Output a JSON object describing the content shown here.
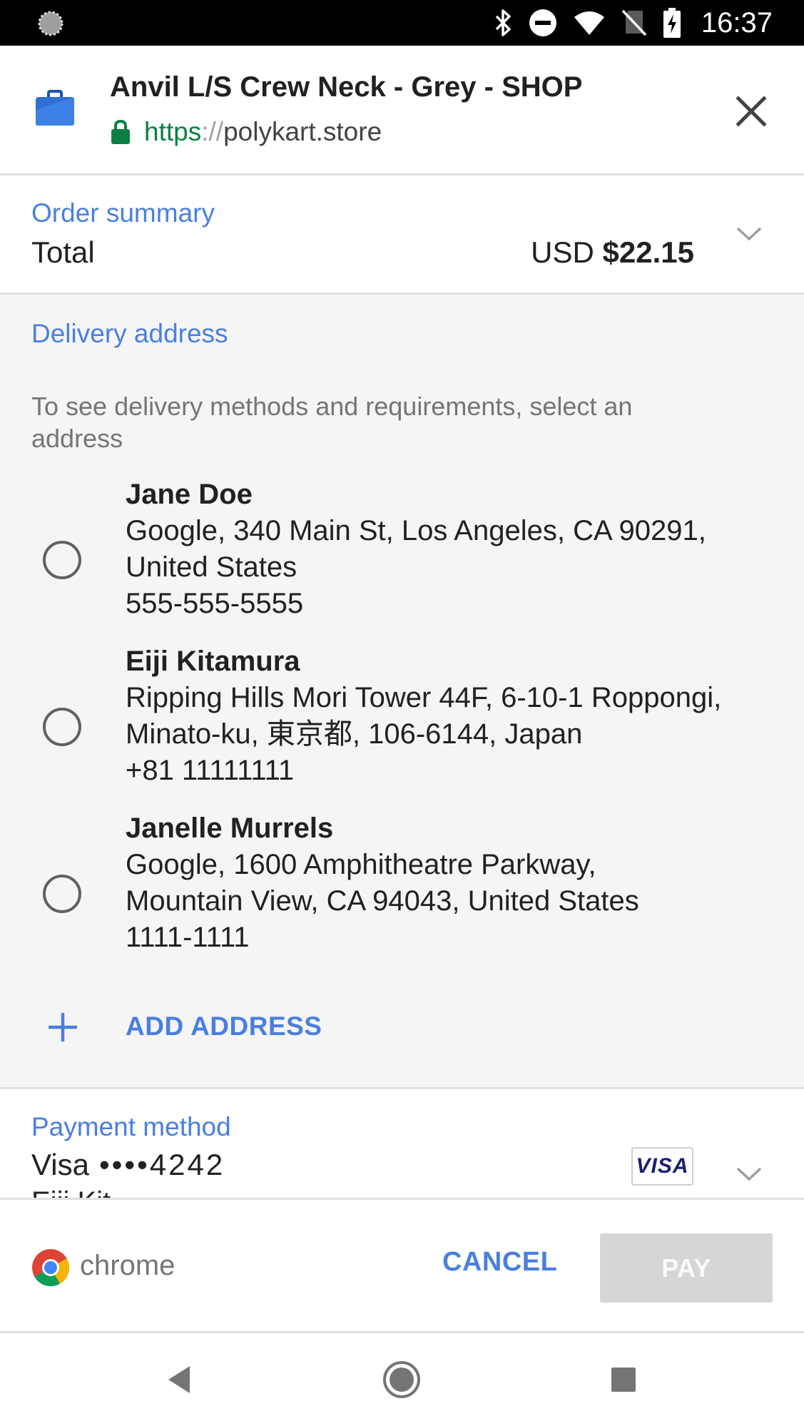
{
  "status_bar": {
    "time": "16:37",
    "icons": [
      "loading-spinner-icon",
      "bluetooth-icon",
      "do-not-disturb-icon",
      "wifi-icon",
      "no-sim-icon",
      "battery-charging-icon"
    ]
  },
  "header": {
    "title": "Anvil L/S Crew Neck - Grey - SHOP",
    "url_scheme": "https",
    "url_separator": "://",
    "url_host": "polykart.store",
    "icons": [
      "shop-bag-icon",
      "lock-icon",
      "close-icon"
    ]
  },
  "order_summary": {
    "label": "Order summary",
    "total_label": "Total",
    "currency": "USD",
    "amount": "$22.15"
  },
  "delivery": {
    "label": "Delivery address",
    "hint": "To see delivery methods and requirements, select an address",
    "addresses": [
      {
        "name": "Jane Doe",
        "line1": "Google, 340 Main St, Los Angeles, CA 90291,",
        "line2": "United States",
        "phone": "555-555-5555",
        "selected": false
      },
      {
        "name": "Eiji Kitamura",
        "line1": "Ripping Hills Mori Tower 44F, 6-10-1 Roppongi,",
        "line2": "Minato-ku, 東京都, 106-6144, Japan",
        "phone": "+81 11111111",
        "selected": false
      },
      {
        "name": "Janelle Murrels",
        "line1": "Google, 1600 Amphitheatre Parkway,",
        "line2": "Mountain View, CA 94043, United States",
        "phone": "1111-1111",
        "selected": false
      }
    ],
    "add_label": "ADD ADDRESS"
  },
  "payment": {
    "label": "Payment method",
    "card_brand": "Visa",
    "card_masked": "••••4242",
    "card_holder_partial": "Eiji Kit",
    "badge_text": "VISA"
  },
  "footer": {
    "brand": "chrome",
    "cancel_label": "CANCEL",
    "pay_label": "PAY"
  },
  "nav_bar": {
    "icons": [
      "back-icon",
      "home-icon",
      "recents-icon"
    ]
  },
  "colors": {
    "accent": "#4a7fde",
    "secure_green": "#0b8043",
    "section_bg": "#f5f5f5",
    "pay_disabled": "#d6d6d6"
  }
}
